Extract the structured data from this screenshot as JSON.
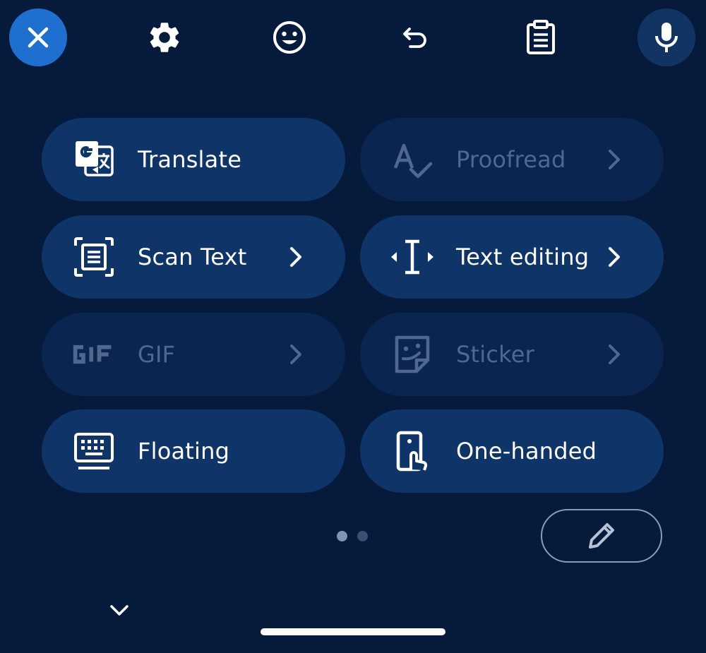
{
  "toolbar": {
    "icons": [
      "close-icon",
      "gear-icon",
      "emoji-icon",
      "undo-icon",
      "clipboard-icon",
      "mic-icon"
    ]
  },
  "tiles": [
    {
      "label": "Translate",
      "icon": "translate-icon",
      "enabled": true,
      "has_chevron": false
    },
    {
      "label": "Proofread",
      "icon": "proofread-icon",
      "enabled": false,
      "has_chevron": true
    },
    {
      "label": "Scan Text",
      "icon": "scan-text-icon",
      "enabled": true,
      "has_chevron": true
    },
    {
      "label": "Text editing",
      "icon": "text-cursor-icon",
      "enabled": true,
      "has_chevron": true
    },
    {
      "label": "GIF",
      "icon": "gif-icon",
      "enabled": false,
      "has_chevron": true
    },
    {
      "label": "Sticker",
      "icon": "sticker-icon",
      "enabled": false,
      "has_chevron": true
    },
    {
      "label": "Floating",
      "icon": "keyboard-icon",
      "enabled": true,
      "has_chevron": false
    },
    {
      "label": "One-handed",
      "icon": "one-handed-icon",
      "enabled": true,
      "has_chevron": false
    }
  ],
  "pagination": {
    "pages": 2,
    "current": 1
  },
  "colors": {
    "background": "#061a3c",
    "tile": "#0f3467",
    "tile_disabled": "#0a2650",
    "accent": "#1f6fcf",
    "disabled_text": "#51688e"
  }
}
